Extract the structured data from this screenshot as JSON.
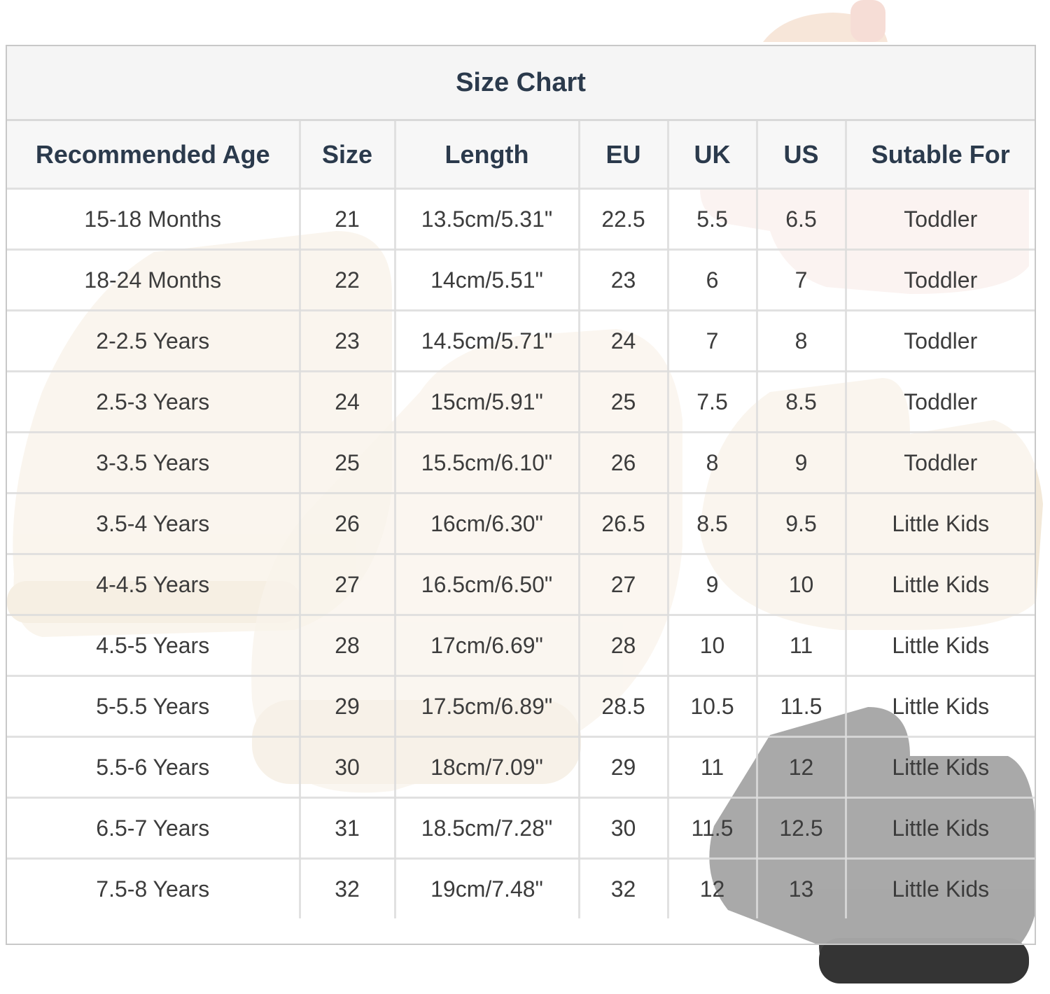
{
  "title": "Size Chart",
  "columns": [
    "Recommended Age",
    "Size",
    "Length",
    "EU",
    "UK",
    "US",
    "Sutable For"
  ],
  "rows": [
    [
      "15-18 Months",
      "21",
      "13.5cm/5.31\"",
      "22.5",
      "5.5",
      "6.5",
      "Toddler"
    ],
    [
      "18-24 Months",
      "22",
      "14cm/5.51\"",
      "23",
      "6",
      "7",
      "Toddler"
    ],
    [
      "2-2.5 Years",
      "23",
      "14.5cm/5.71\"",
      "24",
      "7",
      "8",
      "Toddler"
    ],
    [
      "2.5-3 Years",
      "24",
      "15cm/5.91\"",
      "25",
      "7.5",
      "8.5",
      "Toddler"
    ],
    [
      "3-3.5 Years",
      "25",
      "15.5cm/6.10\"",
      "26",
      "8",
      "9",
      "Toddler"
    ],
    [
      "3.5-4 Years",
      "26",
      "16cm/6.30\"",
      "26.5",
      "8.5",
      "9.5",
      "Little Kids"
    ],
    [
      "4-4.5 Years",
      "27",
      "16.5cm/6.50\"",
      "27",
      "9",
      "10",
      "Little Kids"
    ],
    [
      "4.5-5 Years",
      "28",
      "17cm/6.69\"",
      "28",
      "10",
      "11",
      "Little Kids"
    ],
    [
      "5-5.5 Years",
      "29",
      "17.5cm/6.89\"",
      "28.5",
      "10.5",
      "11.5",
      "Little Kids"
    ],
    [
      "5.5-6 Years",
      "30",
      "18cm/7.09\"",
      "29",
      "11",
      "12",
      "Little Kids"
    ],
    [
      "6.5-7 Years",
      "31",
      "18.5cm/7.28\"",
      "30",
      "11.5",
      "12.5",
      "Little Kids"
    ],
    [
      "7.5-8 Years",
      "32",
      "19cm/7.48\"",
      "32",
      "12",
      "13",
      "Little Kids"
    ]
  ],
  "colors": {
    "header_text": "#2b3a4c",
    "cell_text": "#3c3c3c",
    "grid": "#dcdcdc",
    "boot_beige": "#efe2cc",
    "boot_black": "#1e1e1e",
    "boot_pink": "#f3cfc6"
  }
}
